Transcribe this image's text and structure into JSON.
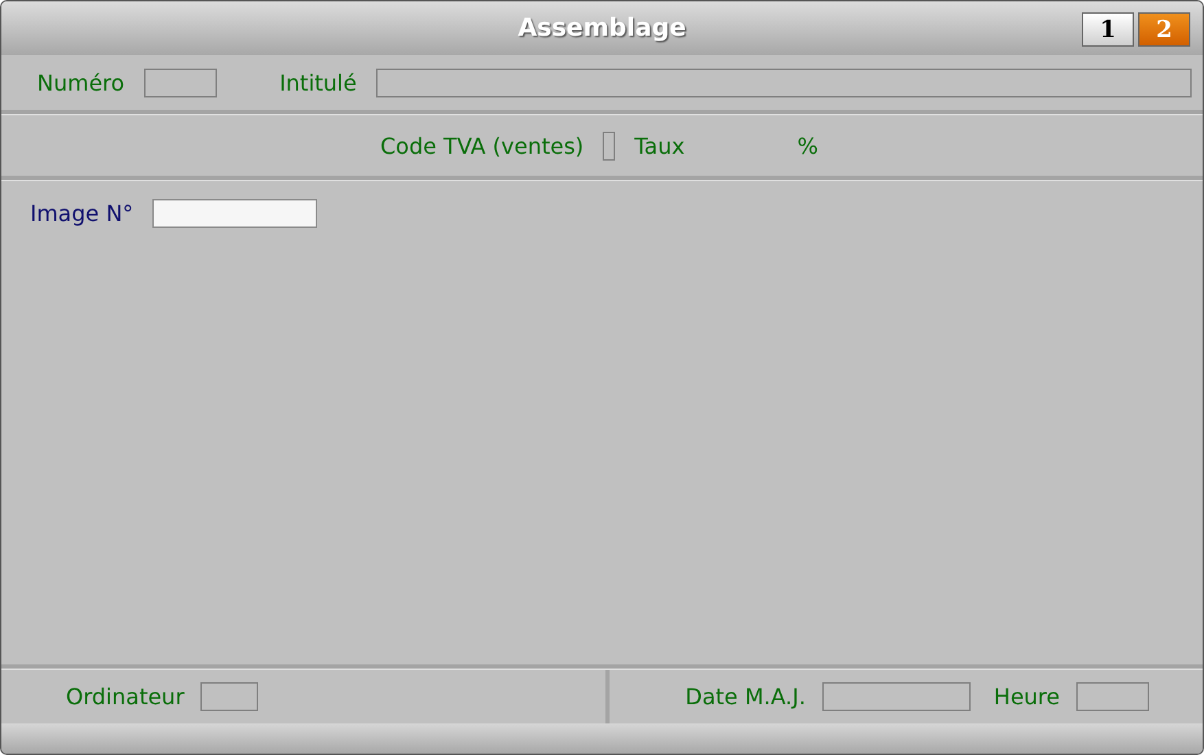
{
  "window": {
    "title": "Assemblage"
  },
  "pages": [
    {
      "label": "1",
      "selected": false
    },
    {
      "label": "2",
      "selected": true
    }
  ],
  "header_row": [
    {
      "label": "Numéro",
      "disabled": true
    },
    {
      "label": "Intitulé",
      "disabled": true
    }
  ],
  "tax_row": {
    "code_field": {
      "label": "Code TVA (ventes)",
      "disabled": true
    },
    "rate_label": "Taux",
    "percent_sign": "%"
  },
  "image_field": {
    "label": "Image N°",
    "disabled": false
  },
  "footer_left": {
    "label": "Ordinateur",
    "disabled": true
  },
  "footer_right": [
    {
      "label": "Date M.A.J.",
      "disabled": true
    },
    {
      "label": "Heure",
      "disabled": true
    }
  ]
}
